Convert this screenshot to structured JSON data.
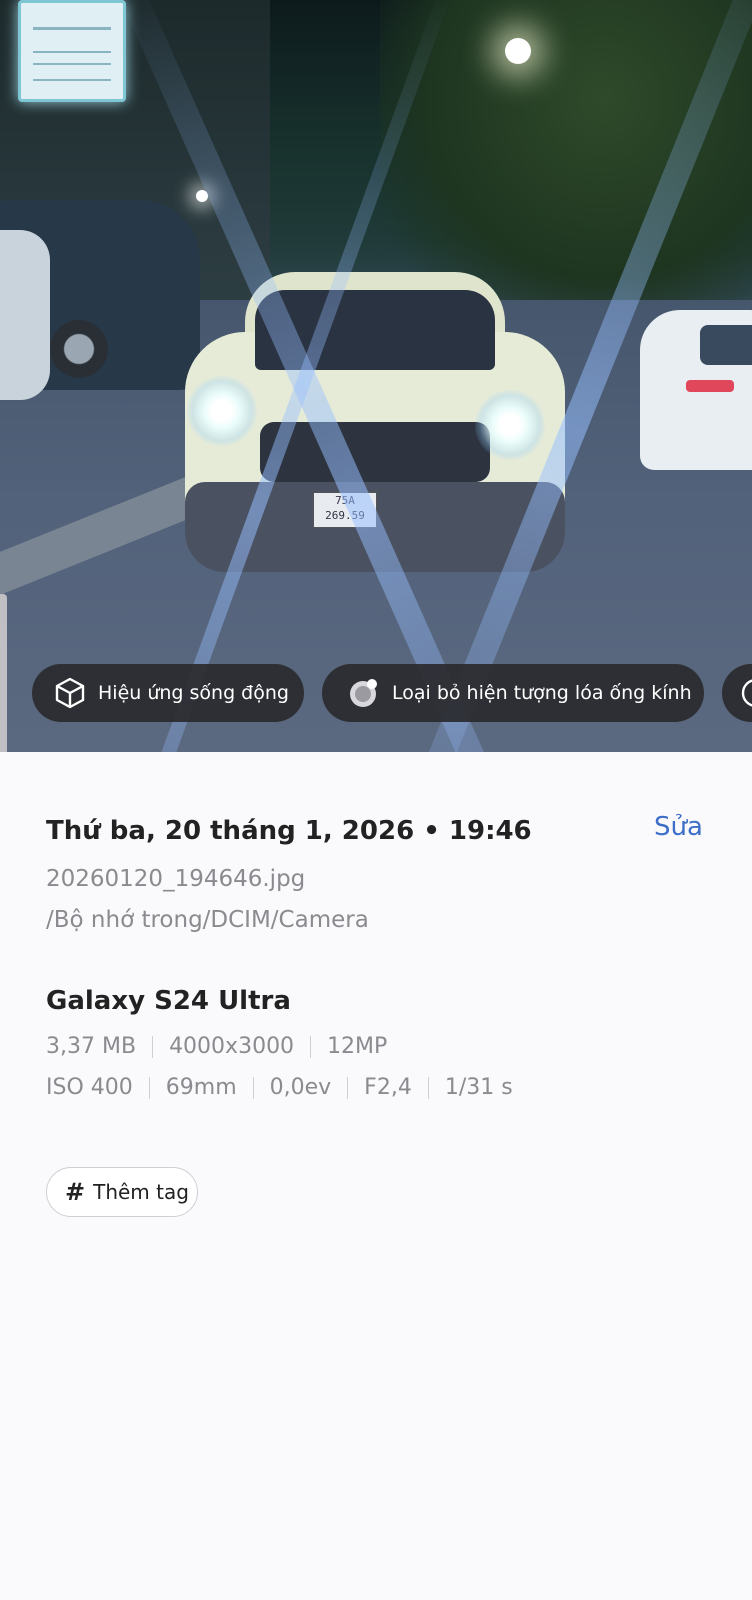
{
  "photo": {
    "plate_line1": "75A",
    "plate_line2": "269.59"
  },
  "chips": [
    {
      "label": "Hiệu ứng sống động",
      "icon": "motion-cube-icon"
    },
    {
      "label": "Loại bỏ hiện tượng lóa ống kính",
      "icon": "lens-flare-icon"
    },
    {
      "label": "",
      "icon": "more-suggestion-icon"
    }
  ],
  "details": {
    "date": "Thứ ba, 20 tháng 1, 2026 • 19:46",
    "edit_label": "Sửa",
    "file_name": "20260120_194646.jpg",
    "file_path": "/Bộ nhớ trong/DCIM/Camera",
    "device": "Galaxy S24 Ultra",
    "specs_row1": [
      "3,37 MB",
      "4000x3000",
      "12MP"
    ],
    "specs_row2": [
      "ISO 400",
      "69mm",
      "0,0ev",
      "F2,4",
      "1/31 s"
    ],
    "tag_label": "Thêm tag"
  },
  "colors": {
    "accent": "#3d6fc9",
    "chip_bg": "#2a2a2e",
    "panel_bg": "#fafafd",
    "secondary_text": "#8a8a8f"
  }
}
